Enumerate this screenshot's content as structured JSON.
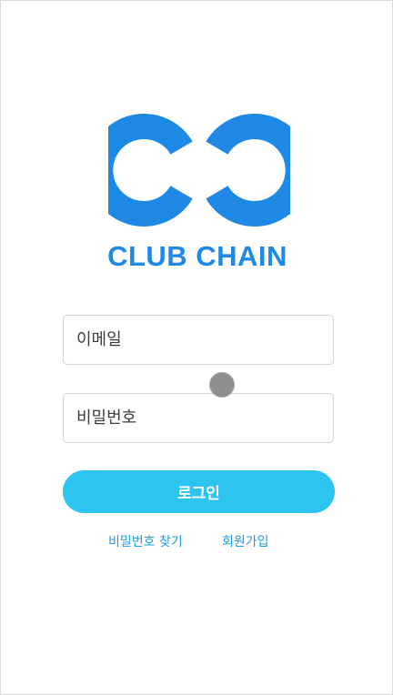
{
  "brand": {
    "name": "CLUB CHAIN",
    "color": "#1e88e5",
    "logo_icon": "infinity-chain-icon"
  },
  "form": {
    "email_placeholder": "이메일",
    "password_placeholder": "비밀번호",
    "login_label": "로그인",
    "accent_color": "#2ec4f2"
  },
  "links": {
    "find_password": "비밀번호 찾기",
    "sign_up": "회원가입",
    "color": "#1e9be0"
  }
}
